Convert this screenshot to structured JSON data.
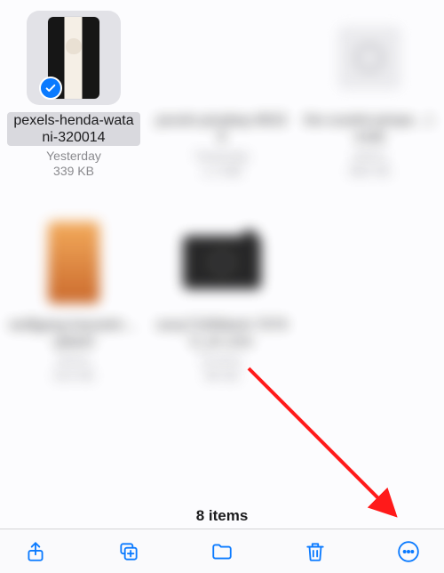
{
  "items": [
    {
      "name": "pexels-henda-watani-320014",
      "date": "Yesterday",
      "size": "339 KB",
      "selected": true,
      "shape": "portrait",
      "art": "art-cat"
    },
    {
      "name": "pexels-pixabay-86328",
      "date": "Yesterday",
      "size": "1.2 MB",
      "selected": false,
      "shape": "portrait",
      "art": "art-sunset"
    },
    {
      "name": "the-scarlet-pimpe…l.mobi",
      "date": "4/9/21",
      "size": "890 KB",
      "selected": false,
      "shape": "square",
      "art": "art-face"
    },
    {
      "name": "wolfgang-hasselm…uplash",
      "date": "3/2/21",
      "size": "510 KB",
      "selected": false,
      "shape": "portrait",
      "art": "art-orange"
    },
    {
      "name": "sony7100black-70790_en.com",
      "date": "2/14/21",
      "size": "96 KB",
      "selected": false,
      "shape": "wide",
      "art": "art-cam"
    }
  ],
  "count_label": "8 items",
  "toolbar": {
    "share": "Share",
    "dup": "Duplicate",
    "move": "Move",
    "delete": "Delete",
    "more": "More"
  },
  "arrow_target": "more-button"
}
